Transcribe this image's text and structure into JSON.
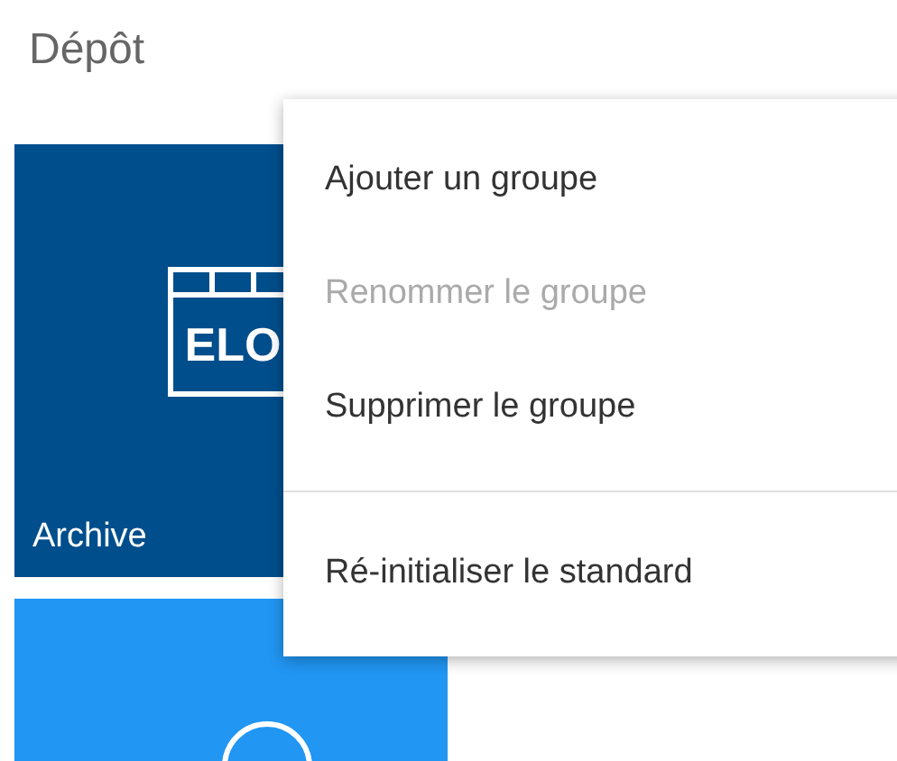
{
  "header": {
    "title": "Dépôt"
  },
  "tiles": [
    {
      "label": "Archive",
      "logo_text": "ELO",
      "color": "#004e8c"
    },
    {
      "color": "#2196f3"
    }
  ],
  "context_menu": {
    "items": [
      {
        "label": "Ajouter un groupe",
        "disabled": false,
        "separator_before": false
      },
      {
        "label": "Renommer le groupe",
        "disabled": true,
        "separator_before": false
      },
      {
        "label": "Supprimer le groupe",
        "disabled": false,
        "separator_before": false
      },
      {
        "label": "Ré-initialiser le standard",
        "disabled": false,
        "separator_before": true
      }
    ]
  }
}
